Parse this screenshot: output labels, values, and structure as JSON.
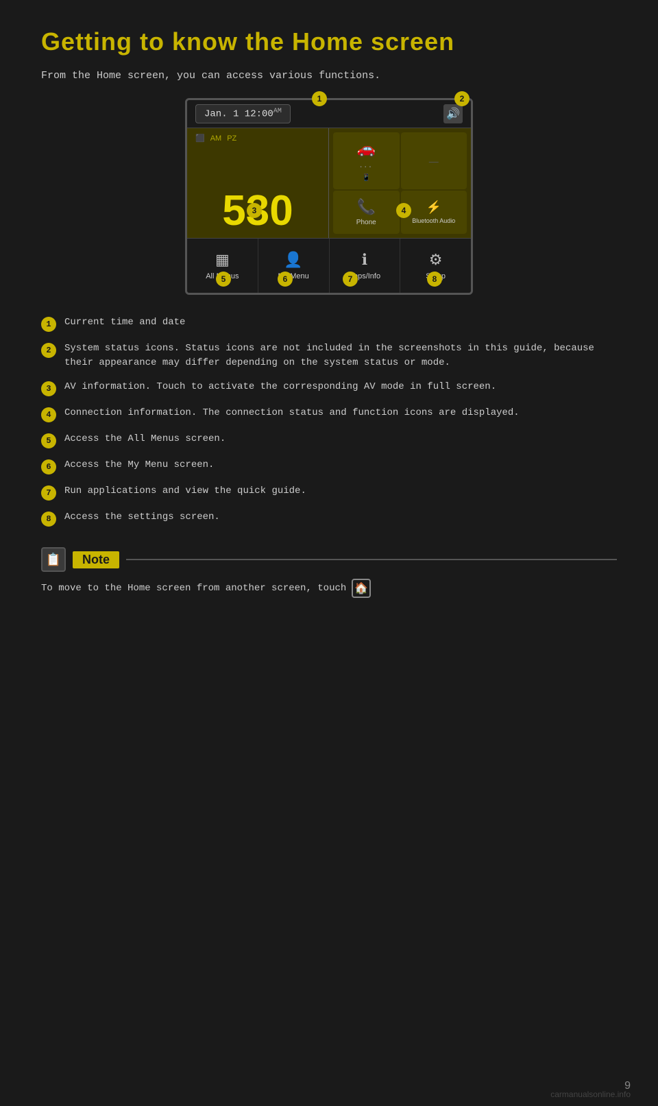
{
  "page": {
    "title": "Getting to know the Home screen",
    "subtitle": "From the Home screen, you can access various functions.",
    "page_number": "9",
    "watermark": "carmanualsonline.info"
  },
  "screen": {
    "datetime": "Jan.  1    12:00",
    "am_label": "AM",
    "freq_label": "AM",
    "freq_sub": "PZ",
    "freq_value": "530",
    "speaker_icon": "🔊",
    "connection_cells": [
      {
        "icon": "🚗",
        "label": "",
        "dots": "···"
      },
      {
        "icon": "📱",
        "label": ""
      },
      {
        "icon": "📞",
        "label": "Phone"
      },
      {
        "icon": "⚡",
        "label": "Bluetooth Audio"
      }
    ],
    "menu_items": [
      {
        "icon": "▦",
        "label": "All Menus"
      },
      {
        "icon": "👤",
        "label": "My Menu"
      },
      {
        "icon": "ℹ",
        "label": "Apps/Info"
      },
      {
        "icon": "⚙",
        "label": "Setup"
      }
    ]
  },
  "callouts": [
    {
      "num": "1",
      "text": "Current time and date"
    },
    {
      "num": "2",
      "text": "System status icons. Status icons are not included in the screenshots in this guide, because their appearance may differ depending on the system status or mode."
    },
    {
      "num": "3",
      "text": "AV information. Touch to activate the corresponding AV mode in full screen."
    },
    {
      "num": "4",
      "text": "Connection information. The connection status and function icons are displayed."
    },
    {
      "num": "5",
      "text": "Access the All Menus screen."
    },
    {
      "num": "6",
      "text": "Access the My Menu screen."
    },
    {
      "num": "7",
      "text": "Run applications and view the quick guide."
    },
    {
      "num": "8",
      "text": "Access the settings screen."
    }
  ],
  "note": {
    "label": "Note",
    "content": "To move to the Home screen from another screen, touch"
  }
}
